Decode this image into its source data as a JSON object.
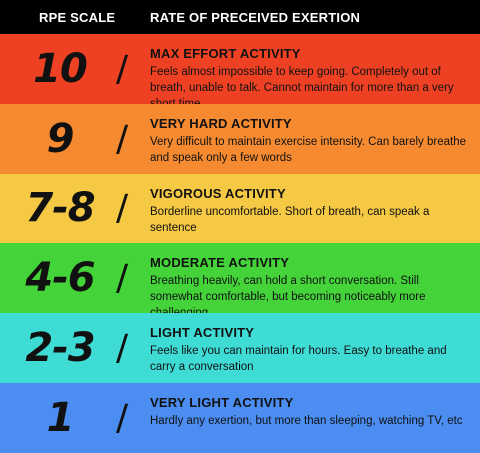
{
  "header": {
    "col1": "RPE SCALE",
    "col2": "RATE OF PRECEIVED EXERTION"
  },
  "rows": [
    {
      "level": "10",
      "title": "MAX EFFORT ACTIVITY",
      "desc": "Feels almost impossible to keep going. Completely out of breath, unable to talk. Cannot maintain for more than a very short time",
      "color": "#ee4123"
    },
    {
      "level": "9",
      "title": "VERY HARD ACTIVITY",
      "desc": "Very difficult to maintain exercise intensity. Can barely breathe and speak only a few words",
      "color": "#f58a31"
    },
    {
      "level": "7-8",
      "title": "VIGOROUS ACTIVITY",
      "desc": "Borderline uncomfortable. Short of breath, can speak a sentence",
      "color": "#f6c944"
    },
    {
      "level": "4-6",
      "title": "MODERATE ACTIVITY",
      "desc": "Breathing heavily, can hold a short conversation. Still somewhat comfortable, but becoming noticeably more challenging",
      "color": "#44d43a"
    },
    {
      "level": "2-3",
      "title": "LIGHT ACTIVITY",
      "desc": "Feels like you can maintain for hours. Easy to breathe and carry a conversation",
      "color": "#3fdcd6"
    },
    {
      "level": "1",
      "title": "VERY LIGHT ACTIVITY",
      "desc": "Hardly any exertion, but more than sleeping, watching TV, etc",
      "color": "#4b8df0"
    }
  ]
}
